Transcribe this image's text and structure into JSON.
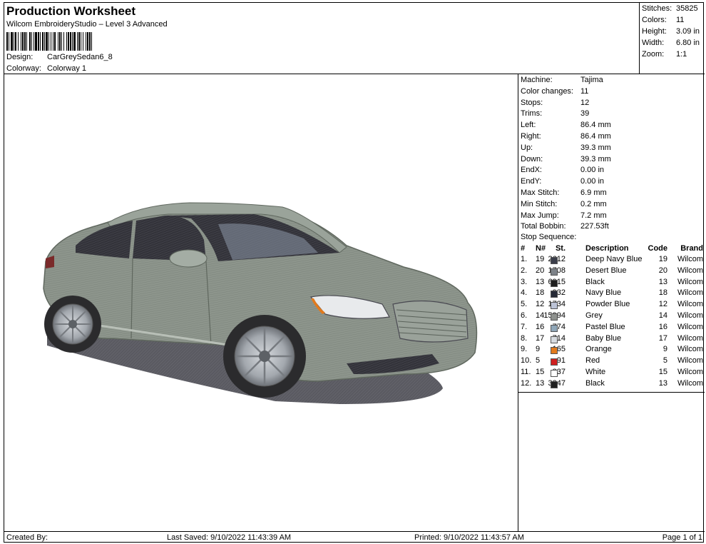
{
  "header": {
    "title": "Production Worksheet",
    "subtitle": "Wilcom EmbroideryStudio – Level 3 Advanced",
    "design_label": "Design:",
    "design_value": "CarGreySedan6_8",
    "colorway_label": "Colorway:",
    "colorway_value": "Colorway 1"
  },
  "stats": {
    "stitches_label": "Stitches:",
    "stitches": "35825",
    "colors_label": "Colors:",
    "colors": "11",
    "height_label": "Height:",
    "height": "3.09 in",
    "width_label": "Width:",
    "width": "6.80 in",
    "zoom_label": "Zoom:",
    "zoom": "1:1"
  },
  "machine": [
    {
      "label": "Machine:",
      "value": "Tajima"
    },
    {
      "label": "Color changes:",
      "value": "11"
    },
    {
      "label": "Stops:",
      "value": "12"
    },
    {
      "label": "Trims:",
      "value": "39"
    },
    {
      "label": "Left:",
      "value": "86.4 mm"
    },
    {
      "label": "Right:",
      "value": "86.4 mm"
    },
    {
      "label": "Up:",
      "value": "39.3 mm"
    },
    {
      "label": "Down:",
      "value": "39.3 mm"
    },
    {
      "label": "EndX:",
      "value": "0.00 in"
    },
    {
      "label": "EndY:",
      "value": "0.00 in"
    },
    {
      "label": "Max Stitch:",
      "value": "6.9 mm"
    },
    {
      "label": "Min Stitch:",
      "value": "0.2 mm"
    },
    {
      "label": "Max Jump:",
      "value": "7.2 mm"
    },
    {
      "label": "Total Bobbin:",
      "value": "227.53ft"
    }
  ],
  "stop_sequence": {
    "title": "Stop Sequence:",
    "headers": {
      "idx": "#",
      "n": "N#",
      "st": "St.",
      "desc": "Description",
      "code": "Code",
      "brand": "Brand"
    },
    "rows": [
      {
        "idx": "1.",
        "n": "19",
        "color": "#3b3e4a",
        "st": "2612",
        "desc": "Deep Navy Blue",
        "code": "19",
        "brand": "Wilcom"
      },
      {
        "idx": "2.",
        "n": "20",
        "color": "#7d8288",
        "st": "1708",
        "desc": "Desert Blue",
        "code": "20",
        "brand": "Wilcom"
      },
      {
        "idx": "3.",
        "n": "13",
        "color": "#1f1f1f",
        "st": "6915",
        "desc": "Black",
        "code": "13",
        "brand": "Wilcom"
      },
      {
        "idx": "4.",
        "n": "18",
        "color": "#262a36",
        "st": "932",
        "desc": "Navy Blue",
        "code": "18",
        "brand": "Wilcom"
      },
      {
        "idx": "5.",
        "n": "12",
        "color": "#bcc3d6",
        "st": "1734",
        "desc": "Powder Blue",
        "code": "12",
        "brand": "Wilcom"
      },
      {
        "idx": "6.",
        "n": "14",
        "color": "#8e918e",
        "st": "15994",
        "desc": "Grey",
        "code": "14",
        "brand": "Wilcom"
      },
      {
        "idx": "7.",
        "n": "16",
        "color": "#8fa6b8",
        "st": "774",
        "desc": "Pastel Blue",
        "code": "16",
        "brand": "Wilcom"
      },
      {
        "idx": "8.",
        "n": "17",
        "color": "#d7dbe0",
        "st": "714",
        "desc": "Baby Blue",
        "code": "17",
        "brand": "Wilcom"
      },
      {
        "idx": "9.",
        "n": "9",
        "color": "#e27a1c",
        "st": "165",
        "desc": "Orange",
        "code": "9",
        "brand": "Wilcom"
      },
      {
        "idx": "10.",
        "n": "5",
        "color": "#cf1f1f",
        "st": "91",
        "desc": "Red",
        "code": "5",
        "brand": "Wilcom"
      },
      {
        "idx": "11.",
        "n": "15",
        "color": "#ffffff",
        "st": "837",
        "desc": "White",
        "code": "15",
        "brand": "Wilcom"
      },
      {
        "idx": "12.",
        "n": "13",
        "color": "#1f1f1f",
        "st": "3347",
        "desc": "Black",
        "code": "13",
        "brand": "Wilcom"
      }
    ]
  },
  "footer": {
    "created": "Created By:",
    "saved": "Last Saved: 9/10/2022 11:43:39 AM",
    "printed": "Printed: 9/10/2022 11:43:57 AM",
    "page": "Page 1 of 1"
  },
  "colors": {
    "body": "#8c948c",
    "body_dark": "#6c746c",
    "glass": "#2a2a2e",
    "glass_light": "#8b97a8",
    "shadow": "#5c5c62",
    "tire": "#2b2b2d",
    "rim": "#a9adb3"
  }
}
